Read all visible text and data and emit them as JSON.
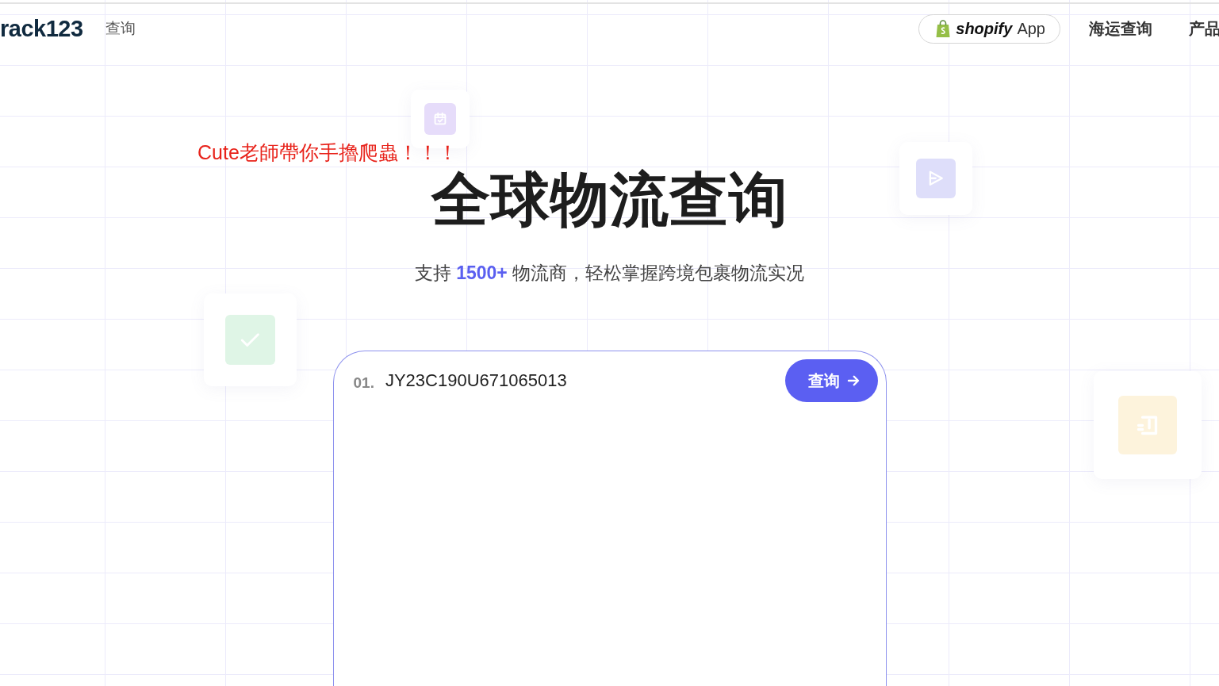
{
  "header": {
    "logo": "rack123",
    "nav_link": "查询",
    "shopify_button": {
      "brand": "shopify",
      "label": "App"
    },
    "nav_items": [
      "海运查询",
      "产品"
    ]
  },
  "overlay_caption": "Cute老師帶你手擼爬蟲！！！",
  "hero": {
    "title": "全球物流查询",
    "subtitle": "支持 **1500+** 物流商，轻松掌握跨境包裹物流实况"
  },
  "search": {
    "line_number": "01.",
    "value": "JY23C190U671065013",
    "button": "查询"
  },
  "decorations": [
    {
      "kind": "calendar"
    },
    {
      "kind": "send"
    },
    {
      "kind": "check"
    },
    {
      "kind": "receipt"
    }
  ]
}
